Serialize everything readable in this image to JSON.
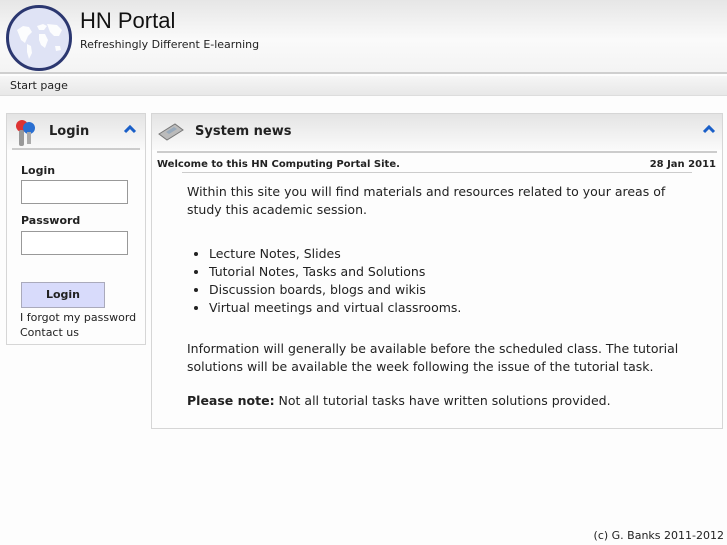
{
  "header": {
    "title": "HN Portal",
    "subtitle": "Refreshingly Different E-learning",
    "logo_icon": "world-map-icon"
  },
  "nav": {
    "start_page": "Start page"
  },
  "login_panel": {
    "title": "Login",
    "icon": "keys-icon",
    "login_label": "Login",
    "login_value": "",
    "password_label": "Password",
    "password_value": "",
    "button": "Login",
    "forgot": "I forgot my password",
    "contact": "Contact us"
  },
  "news_panel": {
    "title": "System news",
    "icon": "newspaper-icon",
    "item_title": "Welcome to this HN Computing Portal Site.",
    "item_date": "28 Jan 2011",
    "para1": "Within this site you will find materials and resources related to your areas of study this academic session.",
    "bullets": [
      "Lecture Notes, Slides",
      "Tutorial Notes, Tasks and Solutions",
      "Discussion boards, blogs and wikis",
      "Virtual meetings and virtual classrooms."
    ],
    "para2": "Information will generally be available before the scheduled class. The tutorial solutions will be available the week following the issue of the tutorial task.",
    "note_label": "Please note:",
    "note_text": " Not all tutorial tasks have written solutions provided."
  },
  "footer": {
    "copyright": "(c) G. Banks 2011-2012"
  },
  "colors": {
    "accent": "#1a5fc8",
    "button": "#d8dbfb",
    "logo_ring": "#2b3770"
  }
}
